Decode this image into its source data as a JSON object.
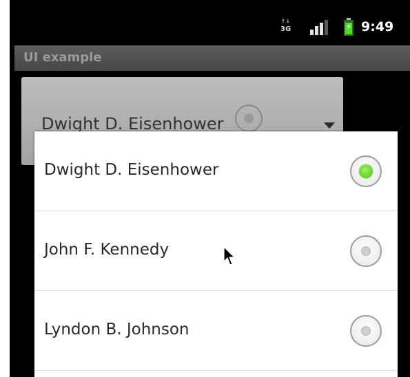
{
  "status_bar": {
    "network_label": "3G",
    "time": "9:49",
    "signal_bars": 3,
    "battery_charging": true
  },
  "app": {
    "title": "UI example"
  },
  "spinner": {
    "selected_value": "Dwight D. Eisenhower"
  },
  "dialog": {
    "items": [
      {
        "label": "Dwight D. Eisenhower",
        "checked": true
      },
      {
        "label": "John F. Kennedy",
        "checked": false
      },
      {
        "label": "Lyndon B. Johnson",
        "checked": false
      }
    ]
  },
  "colors": {
    "radio_checked": "#4bc21c",
    "titlebar": "#464646",
    "statusbar": "#000000"
  }
}
